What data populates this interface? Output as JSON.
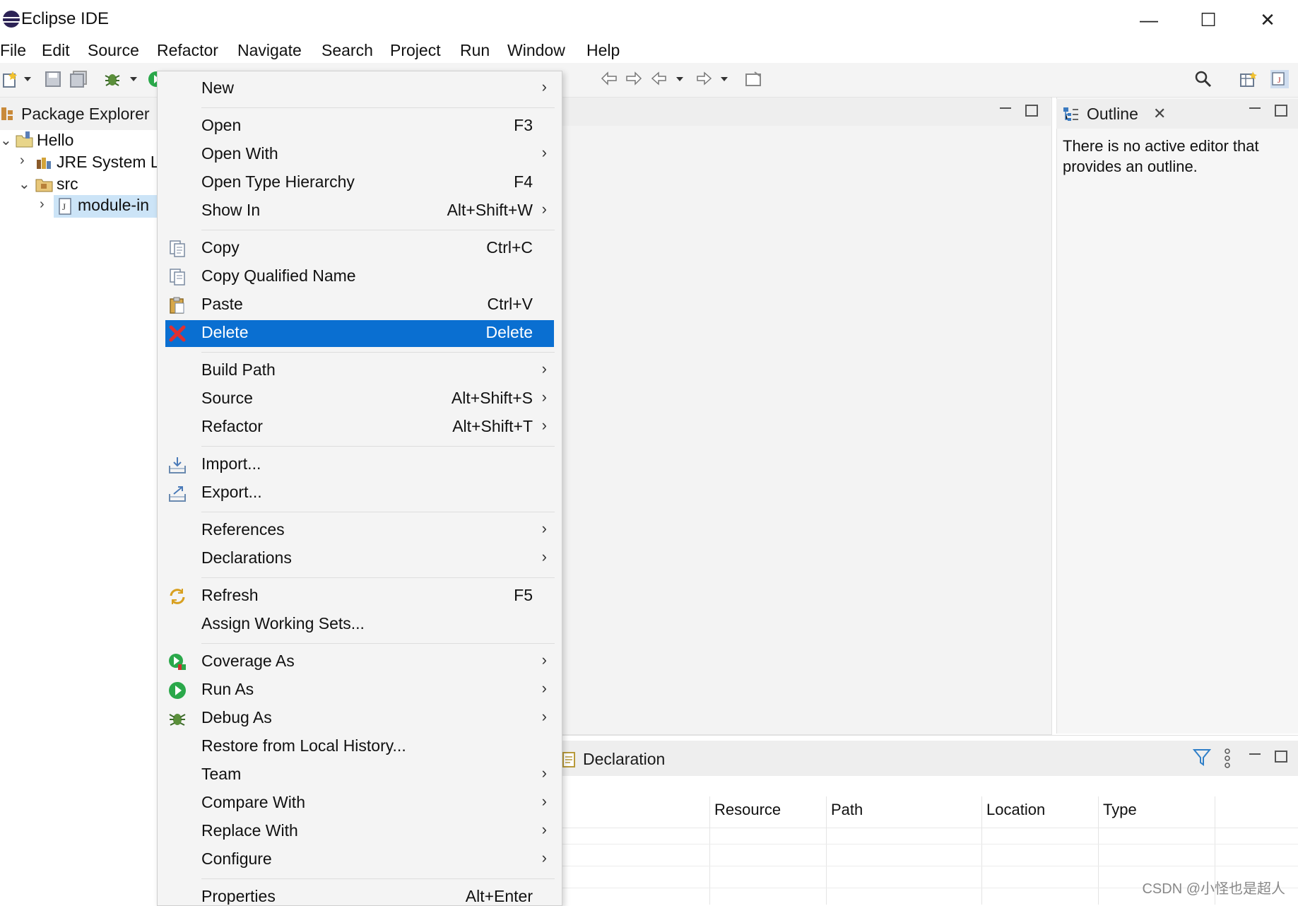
{
  "window": {
    "title": "Eclipse IDE",
    "controls": {
      "minimize": "—",
      "maximize": "☐",
      "close": "✕"
    }
  },
  "menubar": [
    "File",
    "Edit",
    "Source",
    "Refactor",
    "Navigate",
    "Search",
    "Project",
    "Run",
    "Window",
    "Help"
  ],
  "package_explorer": {
    "title": "Package Explorer",
    "tree": [
      {
        "label": "Hello",
        "expanded": true
      },
      {
        "label": "JRE System Li",
        "expanded": false
      },
      {
        "label": "src",
        "expanded": true
      },
      {
        "label": "module-in",
        "expanded": false,
        "selected": true
      }
    ]
  },
  "outline": {
    "title": "Outline",
    "message": "There is no active editor that provides an outline."
  },
  "declaration": {
    "title": "Declaration",
    "columns": [
      "Resource",
      "Path",
      "Location",
      "Type"
    ]
  },
  "context_menu": {
    "items": [
      {
        "label": "New",
        "shortcut": "",
        "submenu": true
      },
      {
        "label": "Open",
        "shortcut": "F3",
        "submenu": false
      },
      {
        "label": "Open With",
        "shortcut": "",
        "submenu": true
      },
      {
        "label": "Open Type Hierarchy",
        "shortcut": "F4",
        "submenu": false
      },
      {
        "label": "Show In",
        "shortcut": "Alt+Shift+W",
        "submenu": true
      },
      {
        "label": "Copy",
        "shortcut": "Ctrl+C",
        "submenu": false,
        "icon": "copy-icon"
      },
      {
        "label": "Copy Qualified Name",
        "shortcut": "",
        "submenu": false,
        "icon": "copy-qualified-icon"
      },
      {
        "label": "Paste",
        "shortcut": "Ctrl+V",
        "submenu": false,
        "icon": "paste-icon"
      },
      {
        "label": "Delete",
        "shortcut": "Delete",
        "submenu": false,
        "icon": "delete-icon",
        "highlighted": true
      },
      {
        "label": "Build Path",
        "shortcut": "",
        "submenu": true
      },
      {
        "label": "Source",
        "shortcut": "Alt+Shift+S",
        "submenu": true
      },
      {
        "label": "Refactor",
        "shortcut": "Alt+Shift+T",
        "submenu": true
      },
      {
        "label": "Import...",
        "shortcut": "",
        "submenu": false,
        "icon": "import-icon"
      },
      {
        "label": "Export...",
        "shortcut": "",
        "submenu": false,
        "icon": "export-icon"
      },
      {
        "label": "References",
        "shortcut": "",
        "submenu": true
      },
      {
        "label": "Declarations",
        "shortcut": "",
        "submenu": true
      },
      {
        "label": "Refresh",
        "shortcut": "F5",
        "submenu": false,
        "icon": "refresh-icon"
      },
      {
        "label": "Assign Working Sets...",
        "shortcut": "",
        "submenu": false
      },
      {
        "label": "Coverage As",
        "shortcut": "",
        "submenu": true,
        "icon": "coverage-icon"
      },
      {
        "label": "Run As",
        "shortcut": "",
        "submenu": true,
        "icon": "run-icon"
      },
      {
        "label": "Debug As",
        "shortcut": "",
        "submenu": true,
        "icon": "debug-icon"
      },
      {
        "label": "Restore from Local History...",
        "shortcut": "",
        "submenu": false
      },
      {
        "label": "Team",
        "shortcut": "",
        "submenu": true
      },
      {
        "label": "Compare With",
        "shortcut": "",
        "submenu": true
      },
      {
        "label": "Replace With",
        "shortcut": "",
        "submenu": true
      },
      {
        "label": "Configure",
        "shortcut": "",
        "submenu": true
      },
      {
        "label": "Properties",
        "shortcut": "Alt+Enter",
        "submenu": false
      }
    ],
    "submenu_arrow": "›"
  },
  "colors": {
    "selection": "#0a6fd1",
    "delete_icon": "#e03030",
    "run_green": "#2aa84a"
  },
  "watermark": "CSDN @小怪也是超人"
}
